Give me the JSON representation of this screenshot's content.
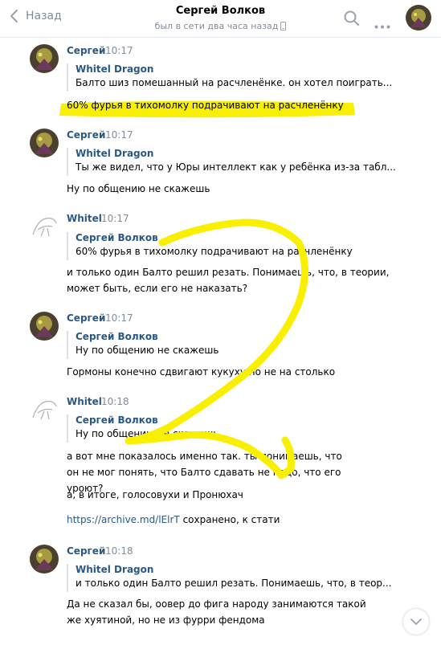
{
  "header": {
    "back_label": "Назад",
    "title": "Сергей Волков",
    "subtitle": "был в сети два часа назад"
  },
  "messages": [
    {
      "author": "Сергей",
      "time": "10:17",
      "quote_author": "Whitel Dragon",
      "quote_text": "Балто шиз помешанный на расчленёнке. он хотел поиграть...",
      "text": "60% фурья в тихомолку подрачивают на расчленёнку"
    },
    {
      "author": "Сергей",
      "time": "10:17",
      "quote_author": "Whitel Dragon",
      "quote_text": "Ты же видел, что у Юры интеллект как у ребёнка из-за табл...",
      "text": "Ну по общению не скажешь"
    },
    {
      "author": "Whitel",
      "time": "10:17",
      "quote_author": "Сергей Волков",
      "quote_text": "60% фурья в тихомолку подрачивают на расчленёнку",
      "text": "и только один Балто решил резать. Понимаешь, что, в теории, может быть, если его не наказать?"
    },
    {
      "author": "Сергей",
      "time": "10:17",
      "quote_author": "Сергей Волков",
      "quote_text": "Ну по общению не скажешь",
      "text": "Гормоны конечно сдвигают кукуху но не на столько"
    },
    {
      "author": "Whitel",
      "time": "10:18",
      "quote_author": "Сергей Волков",
      "quote_text": "Ну по общению не скажешь",
      "text": "а вот мне показалось именно так. ты понимаешь, что он не мог понять, что Балто сдавать не надо, что его уроют?",
      "text2": "а, в итоге, голосовухи и Пронюхач",
      "link": "https://archive.md/lElrT",
      "link_suffix": " сохранено, к стати"
    },
    {
      "author": "Сергей",
      "time": "10:18",
      "quote_author": "Whitel Dragon",
      "quote_text": "и только один Балто решил резать. Понимаешь, что, в теор...",
      "text": "Да не сказал бы, оовер до фига народу занимаются такой же хуятиной, но не из фурри фендома"
    }
  ],
  "colors": {
    "highlight": "#f8f000",
    "link": "#2a5885",
    "secondary": "#818c99"
  }
}
